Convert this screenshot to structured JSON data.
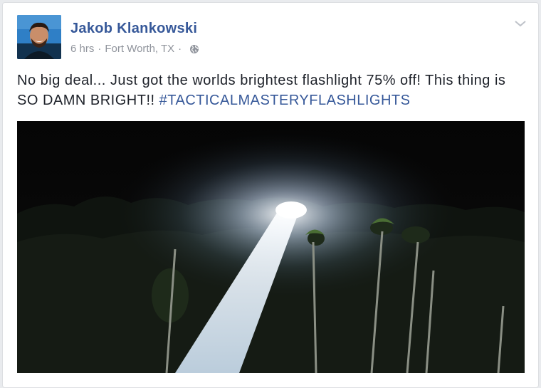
{
  "post": {
    "author": "Jakob Klankowski",
    "time": "6 hrs",
    "separator": "·",
    "location": "Fort Worth, TX",
    "separator2": "·",
    "text_main": "No big deal... Just got the worlds brightest flashlight 75% off! This thing is SO DAMN BRIGHT!! ",
    "hashtag": "#TACTICALMASTERYFLASHLIGHTS"
  },
  "colors": {
    "link": "#365899",
    "meta": "#90949c",
    "text": "#1d2129"
  },
  "icons": {
    "audience": "globe-icon",
    "menu": "chevron-down-icon"
  }
}
